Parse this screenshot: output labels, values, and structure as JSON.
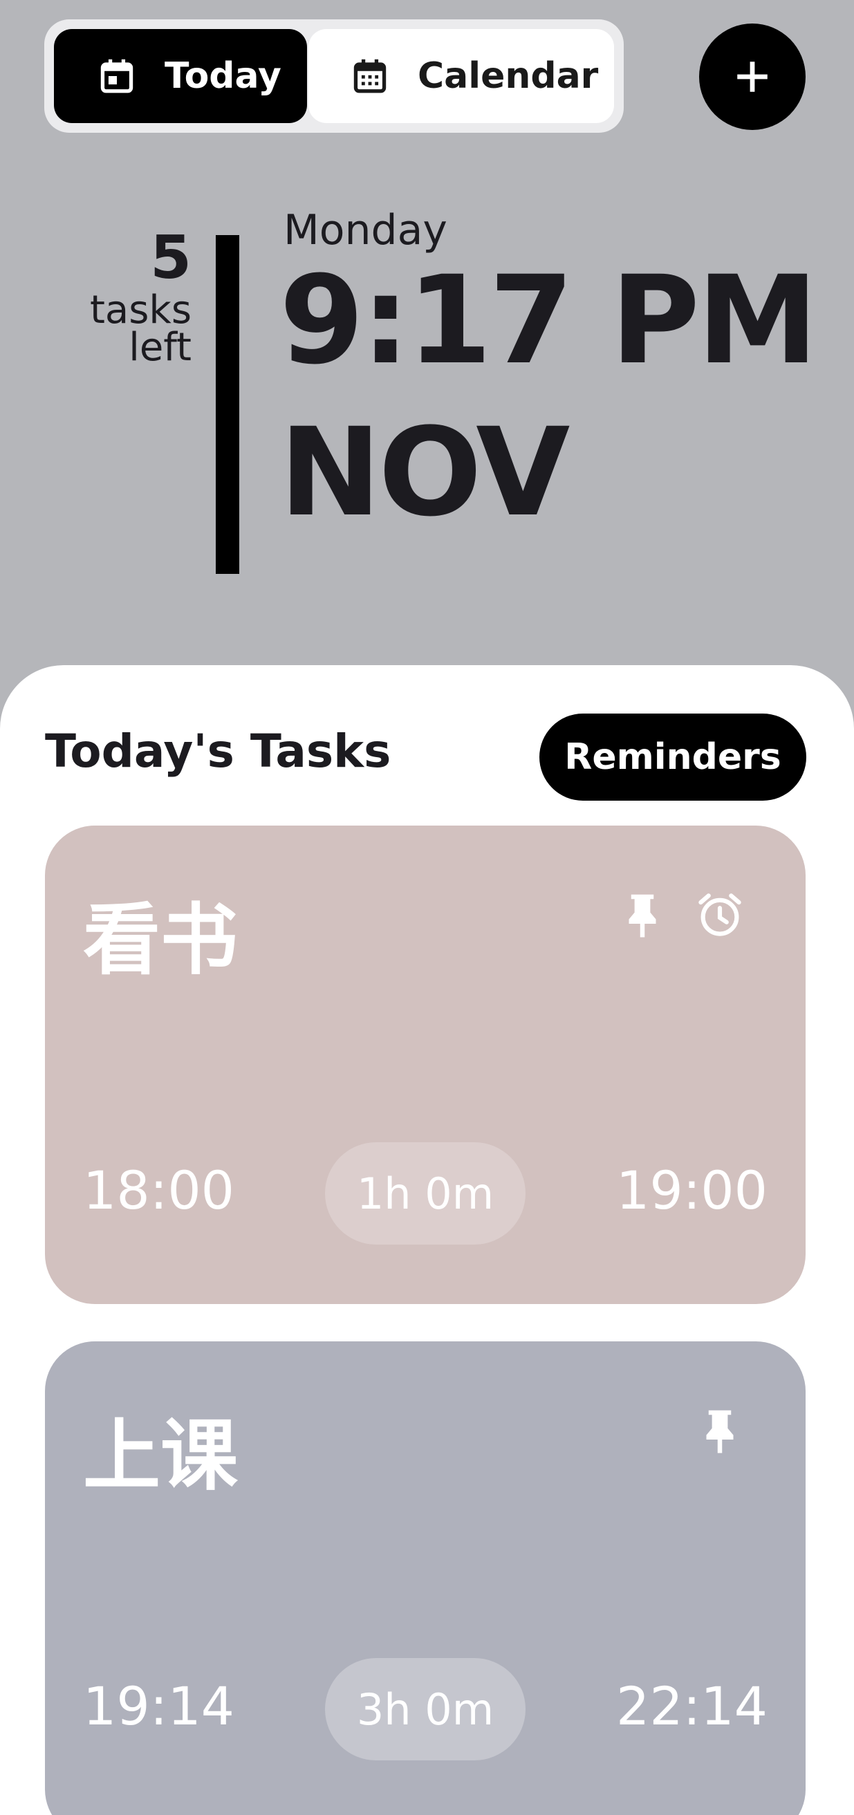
{
  "tabs": {
    "today_label": "Today",
    "calendar_label": "Calendar"
  },
  "header": {
    "tasks_left_count": "5",
    "tasks_left_label_1": "tasks",
    "tasks_left_label_2": "left",
    "weekday": "Monday",
    "time": "9:17 PM",
    "month": "NOV"
  },
  "sheet": {
    "title": "Today's Tasks",
    "reminders_label": "Reminders"
  },
  "tasks": [
    {
      "name": "看书",
      "start": "18:00",
      "duration": "1h 0m",
      "end": "19:00",
      "pinned": true,
      "alarm": true,
      "color": "#d2c1bf"
    },
    {
      "name": "上课",
      "start": "19:14",
      "duration": "3h 0m",
      "end": "22:14",
      "pinned": true,
      "alarm": false,
      "color": "#afb1bc"
    }
  ],
  "colors": {
    "background": "#b5b6ba",
    "accent": "#000000",
    "sheet": "#ffffff"
  },
  "icons": {
    "today_tab": "calendar-today-icon",
    "calendar_tab": "calendar-month-icon",
    "add": "plus-icon",
    "pin": "pin-icon",
    "alarm": "alarm-clock-icon"
  }
}
